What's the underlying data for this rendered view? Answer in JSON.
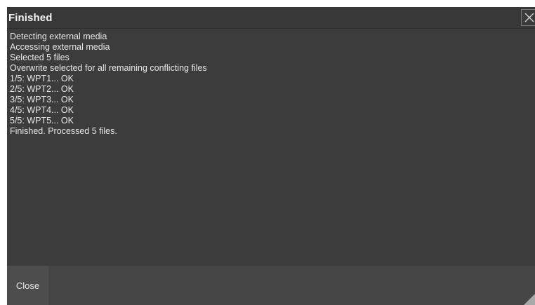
{
  "dialog": {
    "title": "Finished",
    "close_icon": "close-x-icon",
    "log_lines": [
      "Detecting external media",
      "Accessing external media",
      "Selected 5 files",
      "Overwrite selected for all remaining conflicting files",
      "1/5: WPT1... OK",
      "2/5: WPT2... OK",
      "3/5: WPT3... OK",
      "4/5: WPT4... OK",
      "5/5: WPT5... OK",
      "Finished. Processed 5 files."
    ],
    "close_button_label": "Close"
  },
  "colors": {
    "dialog_background": "#3c3c3c",
    "footer_background": "#464646",
    "button_background": "#4d4d4d",
    "text": "#e8e8e8"
  }
}
